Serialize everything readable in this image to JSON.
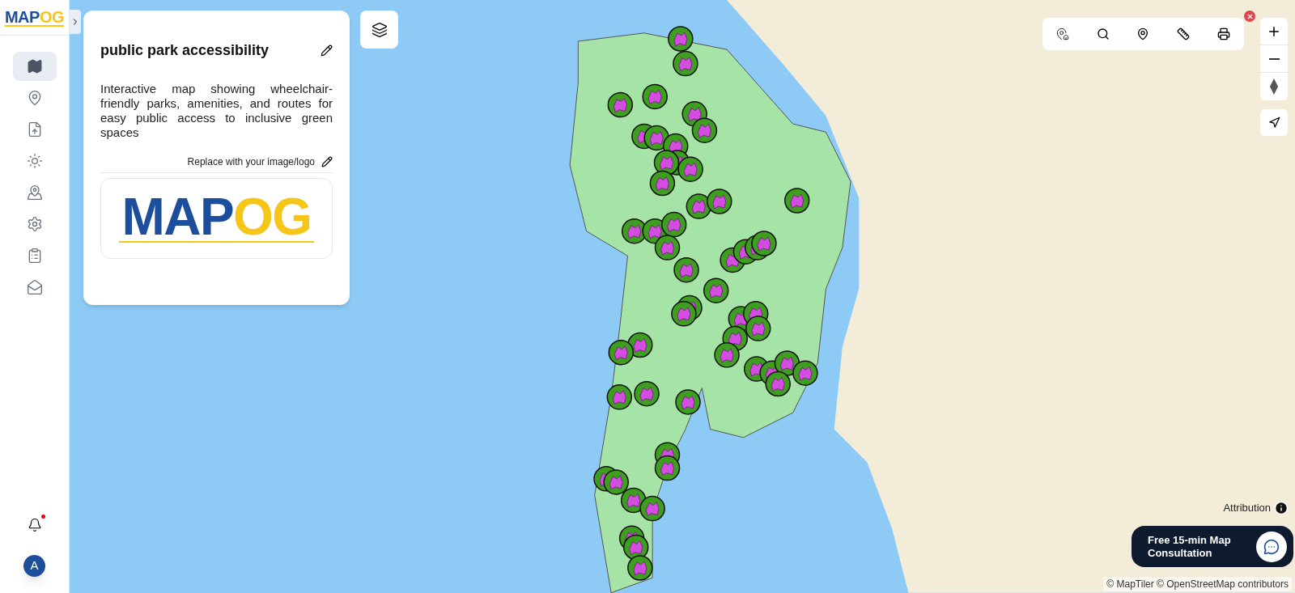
{
  "brand": {
    "left": "MAP",
    "right": "OG"
  },
  "sidebar": {
    "items": [
      {
        "selected": true
      },
      {
        "selected": false
      },
      {
        "selected": false
      },
      {
        "selected": false
      },
      {
        "selected": false
      },
      {
        "selected": false
      },
      {
        "selected": false
      },
      {
        "selected": false
      }
    ],
    "notification_dot": true,
    "avatar": "A"
  },
  "panel": {
    "title": "public park accessibility",
    "description": "Interactive map showing wheelchair-friendly parks, amenities, and routes for easy public access to inclusive green spaces",
    "logo_hint": "Replace with your image/logo",
    "logo": {
      "left": "MAP",
      "right": "OG"
    }
  },
  "map": {
    "attribution": "Attribution",
    "copyright": "© MapTiler © OpenStreetMap contributors"
  },
  "consultation": {
    "label": "Free 15-min Map Consultation"
  }
}
